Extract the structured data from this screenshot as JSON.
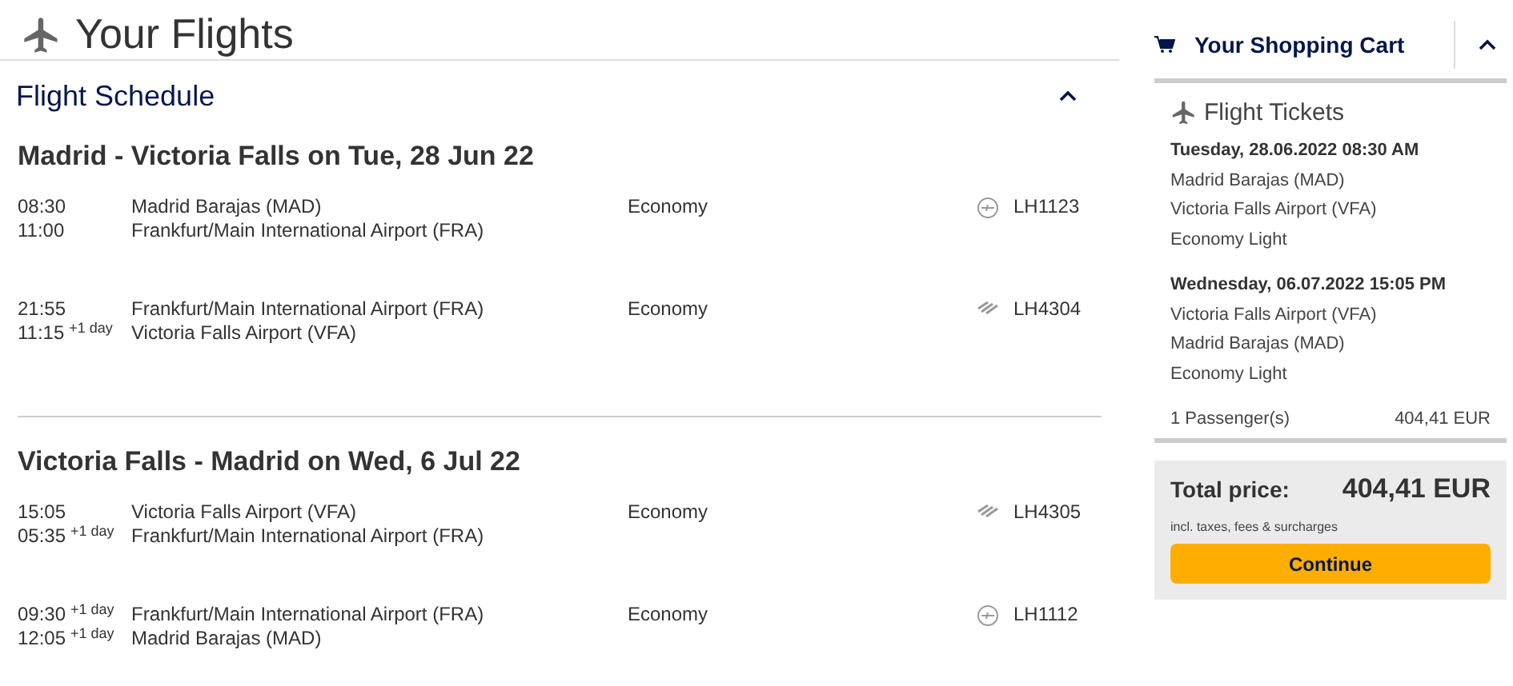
{
  "title": "Your Flights",
  "schedule": {
    "title": "Flight Schedule",
    "expanded": true,
    "journeys": [
      {
        "heading": "Madrid - Victoria Falls on Tue, 28 Jun 22",
        "segments": [
          {
            "dep_time": "08:30",
            "arr_time": "11:00",
            "from": "Madrid Barajas (MAD)",
            "to": "Frankfurt/Main International Airport (FRA)",
            "cabin": "Economy",
            "carrier": {
              "kind": "circle"
            },
            "flight": "LH1123"
          },
          {
            "dep_time": "21:55",
            "arr_time": "11:15",
            "arr_offset": "+1 day",
            "from": "Frankfurt/Main International Airport (FRA)",
            "to": "Victoria Falls Airport (VFA)",
            "cabin": "Economy",
            "carrier": {
              "kind": "stripes"
            },
            "flight": "LH4304"
          }
        ]
      },
      {
        "heading": "Victoria Falls - Madrid on Wed, 6 Jul 22",
        "segments": [
          {
            "dep_time": "15:05",
            "arr_time": "05:35",
            "arr_offset": "+1 day",
            "from": "Victoria Falls Airport (VFA)",
            "to": "Frankfurt/Main International Airport (FRA)",
            "cabin": "Economy",
            "carrier": {
              "kind": "stripes"
            },
            "flight": "LH4305"
          },
          {
            "dep_time": "09:30",
            "arr_time": "12:05",
            "dep_offset": "+1 day",
            "arr_offset": "+1 day",
            "from": "Frankfurt/Main International Airport (FRA)",
            "to": "Madrid Barajas (MAD)",
            "cabin": "Economy",
            "carrier": {
              "kind": "circle"
            },
            "flight": "LH1112"
          }
        ]
      }
    ]
  },
  "cart": {
    "title": "Your Shopping Cart",
    "expanded": true,
    "section": "Flight Tickets",
    "tickets": [
      {
        "date": "Tuesday, 28.06.2022 08:30 AM",
        "lines": [
          "Madrid Barajas (MAD)",
          "Victoria Falls Airport (VFA)",
          "Economy Light"
        ]
      },
      {
        "date": "Wednesday, 06.07.2022 15:05 PM",
        "lines": [
          "Victoria Falls Airport (VFA)",
          "Madrid Barajas (MAD)",
          "Economy Light"
        ]
      }
    ],
    "passengers": "1 Passenger(s)",
    "passenger_price": "404,41 EUR",
    "total_label": "Total price:",
    "total": "404,41 EUR",
    "note": "incl. taxes, fees & surcharges",
    "button": "Continue"
  }
}
